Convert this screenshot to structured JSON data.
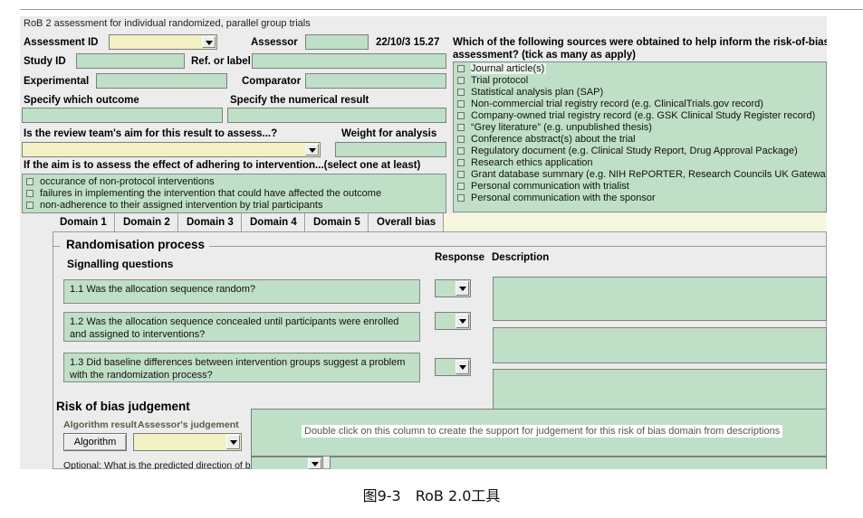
{
  "app": {
    "subtitle": "RoB 2 assessment for individual randomized, parallel group trials",
    "fields": {
      "assessment_id_label": "Assessment ID",
      "assessment_id_value": "",
      "assessor_label": "Assessor",
      "assessor_value": "",
      "timestamp": "22/10/3 15.27",
      "study_id_label": "Study ID",
      "study_id_value": "",
      "ref_label": "Ref. or label",
      "ref_value": "",
      "experimental_label": "Experimental",
      "experimental_value": "",
      "comparator_label": "Comparator",
      "comparator_value": "",
      "outcome_label": "Specify which outcome",
      "outcome_value": "",
      "numerical_result_label": "Specify the numerical result",
      "numerical_result_value": "",
      "aim_label": "Is the review team's aim for this result to assess...?",
      "aim_value": "",
      "weight_label": "Weight for analysis",
      "weight_value": "",
      "adhering_label": "If the aim is to assess the effect of adhering to intervention...(select one at least)"
    },
    "adhering_options": [
      "occurance of non-protocol interventions",
      "failures in implementing the intervention that could have affected the outcome",
      "non-adherence to their assigned intervention by trial participants"
    ],
    "sources": {
      "question": "Which of the following sources were obtained to help inform the risk-of-bias assessment? (tick as many as apply)",
      "options": [
        "Journal article(s)",
        "Trial protocol",
        "Statistical analysis plan (SAP)",
        "Non-commercial trial registry record (e.g. ClinicalTrials.gov record)",
        "Company-owned trial registry record (e.g. GSK Clinical Study Register record)",
        "“Grey literature” (e.g. unpublished thesis)",
        "Conference abstract(s) about the trial",
        "Regulatory document (e.g. Clinical Study Report, Drug Approval Package)",
        "Research ethics application",
        "Grant database summary (e.g. NIH RePORTER, Research Councils UK Gateway to Re",
        "Personal communication with trialist",
        "Personal communication with the sponsor"
      ]
    },
    "tabs": [
      {
        "label": "Domain 1",
        "active": true
      },
      {
        "label": "Domain 2",
        "active": false
      },
      {
        "label": "Domain 3",
        "active": false
      },
      {
        "label": "Domain 4",
        "active": false
      },
      {
        "label": "Domain 5",
        "active": false
      },
      {
        "label": "Overall bias",
        "active": false
      }
    ],
    "domain": {
      "group_title": "Randomisation process",
      "col_questions": "Signalling questions",
      "col_response": "Response",
      "col_description": "Description",
      "questions": [
        {
          "text": "1.1 Was the allocation sequence random?",
          "response": "",
          "description": ""
        },
        {
          "text": "1.2 Was the allocation sequence concealed until participants were enrolled and assigned to interventions?",
          "response": "",
          "description": ""
        },
        {
          "text": "1.3 Did baseline differences between intervention groups suggest a problem with the randomization process?",
          "response": "",
          "description": ""
        }
      ],
      "judgement_title": "Risk of bias judgement",
      "algorithm_result_label": "Algorithm result",
      "algorithm_button": "Algorithm",
      "assessor_judgement_label": "Assessor's judgement",
      "assessor_judgement_value": "",
      "support_hint": "Double click on this column to create the support for judgement for this risk of bias domain from descriptions",
      "optional_label": "Optional: What is the predicted direction of bias arising",
      "optional_value": "",
      "optional_description": ""
    },
    "colors": {
      "field_green": "#bfdfc6",
      "combo_yellow": "#f2f0c4",
      "tab_band": "#f7f7e0",
      "app_bg": "#ececec"
    }
  },
  "caption": "图9-3　RoB 2.0工具"
}
